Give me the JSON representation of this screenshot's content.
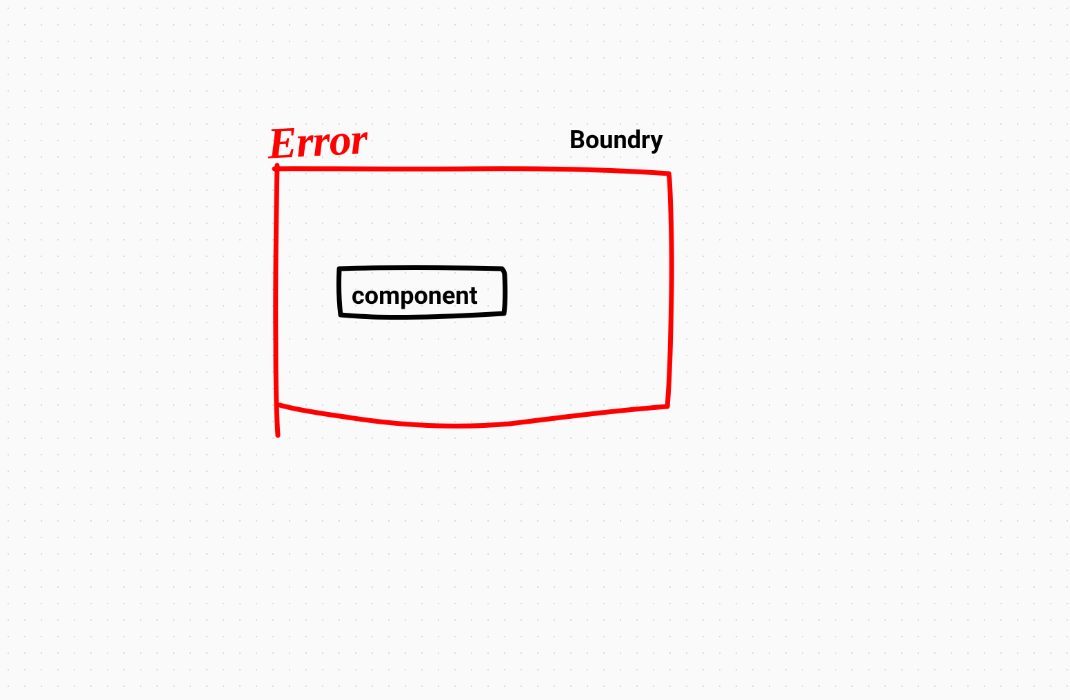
{
  "diagram": {
    "error_label": "Error",
    "boundary_label": "Boundry",
    "component_label": "component",
    "colors": {
      "error": "#ff0000",
      "text": "#000000",
      "background": "#fafafa",
      "dots": "#d0d0d0"
    },
    "description": "Hand-drawn style diagram showing an Error Boundary (red rectangle) containing a component (black rectangle)"
  }
}
